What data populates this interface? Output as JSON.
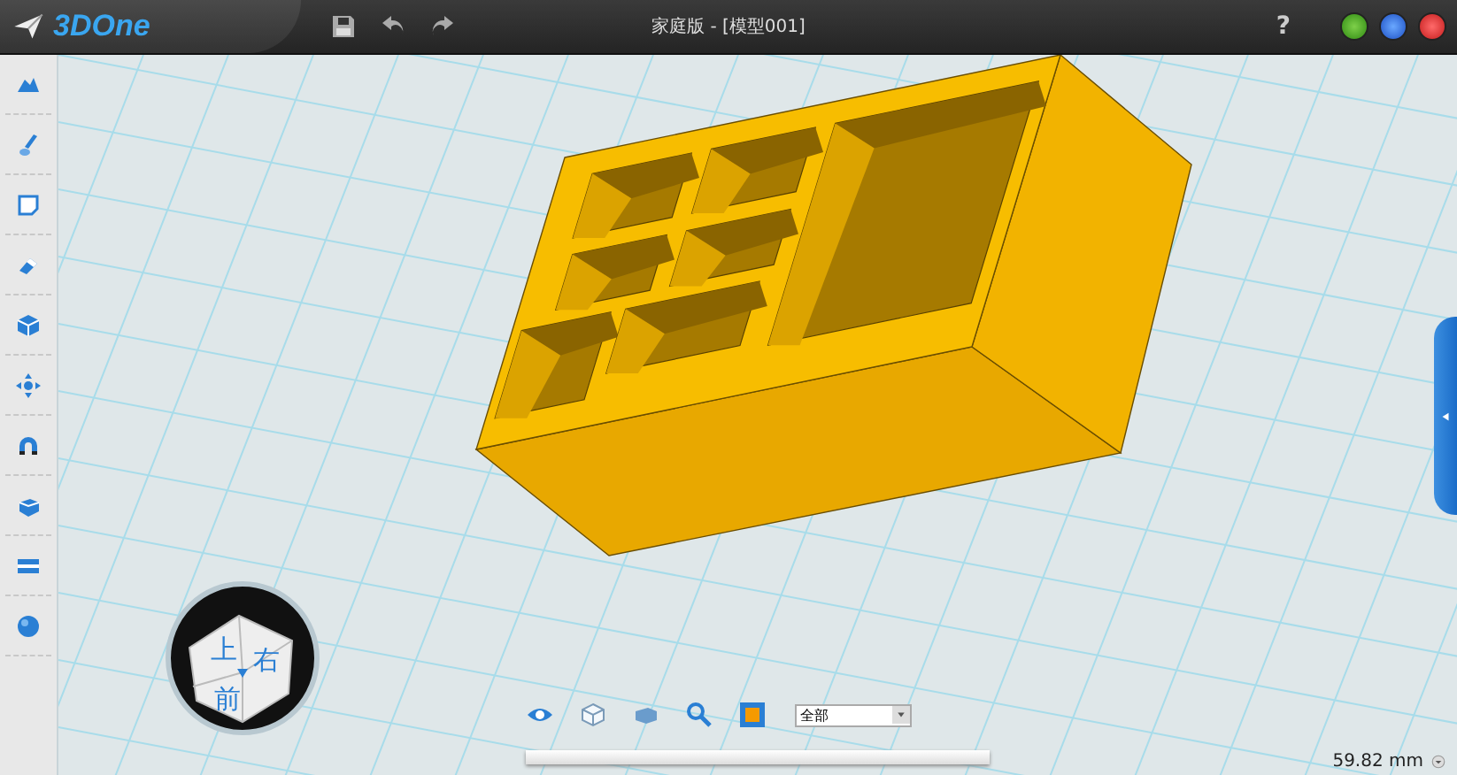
{
  "title_bar": {
    "logo": "3DOne",
    "title": "家庭版 - [模型001]",
    "help": "?"
  },
  "view_cube": {
    "top": "上",
    "right": "右",
    "front": "前"
  },
  "bottom_toolbar": {
    "filter": {
      "value": "全部"
    }
  },
  "status": {
    "measurement": "59.82 mm"
  }
}
